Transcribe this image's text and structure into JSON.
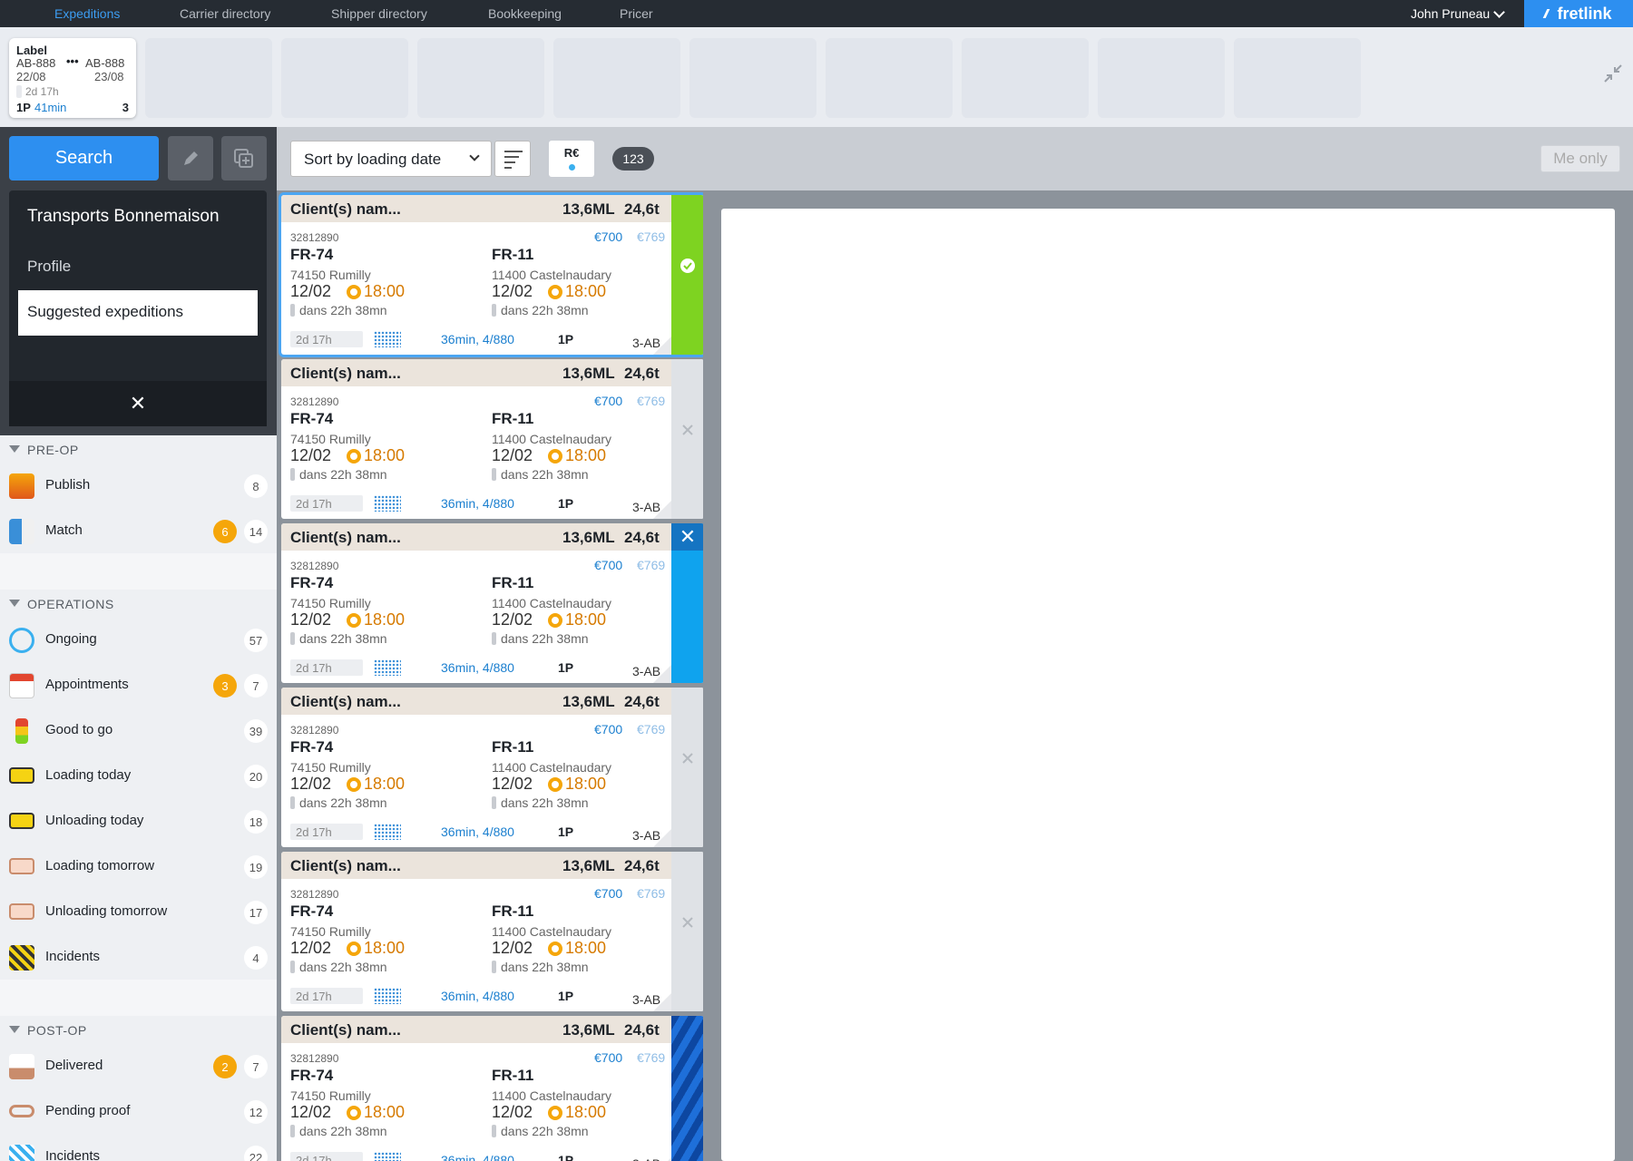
{
  "nav": {
    "items": [
      {
        "label": "Expeditions",
        "active": true
      },
      {
        "label": "Carrier directory",
        "active": false
      },
      {
        "label": "Shipper directory",
        "active": false
      },
      {
        "label": "Bookkeeping",
        "active": false
      },
      {
        "label": "Pricer",
        "active": false
      }
    ],
    "user": "John Pruneau",
    "brand": "fretlink"
  },
  "tab": {
    "label": "Label",
    "from_ref": "AB-888",
    "dots": "•••",
    "to_ref": "AB-888",
    "from_date": "22/08",
    "to_date": "23/08",
    "duration": "2d 17h",
    "pallets": "1P",
    "minutes": "41min",
    "count": "3"
  },
  "sidebar": {
    "search_label": "Search",
    "company": "Transports Bonnemaison",
    "profile": "Profile",
    "suggested": "Suggested expeditions",
    "close": "✕",
    "sections": [
      {
        "title": "PRE-OP",
        "items": [
          {
            "label": "Publish",
            "count": "8",
            "alert": null,
            "icon": "publish-icon"
          },
          {
            "label": "Match",
            "count": "14",
            "alert": "6",
            "icon": "truck-icon"
          }
        ]
      },
      {
        "title": "OPERATIONS",
        "items": [
          {
            "label": "Ongoing",
            "count": "57",
            "alert": null,
            "icon": "refresh-icon"
          },
          {
            "label": "Appointments",
            "count": "7",
            "alert": "3",
            "icon": "calendar-icon"
          },
          {
            "label": "Good to go",
            "count": "39",
            "alert": null,
            "icon": "traffic-light-icon"
          },
          {
            "label": "Loading today",
            "count": "20",
            "alert": null,
            "icon": "loading-icon"
          },
          {
            "label": "Unloading today",
            "count": "18",
            "alert": null,
            "icon": "unloading-icon"
          },
          {
            "label": "Loading tomorrow",
            "count": "19",
            "alert": null,
            "icon": "loading-tomorrow-icon"
          },
          {
            "label": "Unloading tomorrow",
            "count": "17",
            "alert": null,
            "icon": "unloading-tomorrow-icon"
          },
          {
            "label": "Incidents",
            "count": "4",
            "alert": null,
            "icon": "incident-icon"
          }
        ]
      },
      {
        "title": "POST-OP",
        "items": [
          {
            "label": "Delivered",
            "count": "7",
            "alert": "2",
            "icon": "delivered-icon"
          },
          {
            "label": "Pending proof",
            "count": "12",
            "alert": null,
            "icon": "glasses-icon"
          },
          {
            "label": "Incidents",
            "count": "22",
            "alert": null,
            "icon": "incident-icon"
          }
        ]
      }
    ]
  },
  "toolbar": {
    "sort_label": "Sort by loading date",
    "rc_label": "R€",
    "count": "123",
    "me_only": "Me only"
  },
  "card": {
    "client": "Client(s) nam...",
    "ml": "13,6ML",
    "weight": "24,6t",
    "ref": "32812890",
    "price": "€700",
    "price_alt": "€769",
    "from_code": "FR-74",
    "to_code": "FR-11",
    "from_city": "74150 Rumilly",
    "to_city": "11400 Castelnaudary",
    "from_date": "12/02",
    "to_date": "12/02",
    "from_time": "18:00",
    "to_time": "18:00",
    "from_rel": "dans 22h 38mn",
    "to_rel": "dans 22h 38mn",
    "duration": "2d 17h",
    "route": "36min, 4/880",
    "pallets": "1P",
    "code": "3-AB"
  },
  "cards": [
    {
      "status": "accepted",
      "side": "green"
    },
    {
      "status": "neutral",
      "side": "grey"
    },
    {
      "status": "rejected",
      "side": "blue"
    },
    {
      "status": "neutral",
      "side": "grey"
    },
    {
      "status": "neutral",
      "side": "grey"
    },
    {
      "status": "locked",
      "side": "striped"
    }
  ],
  "colors": {
    "accent": "#2d8ff0",
    "nav_bg": "#262c33",
    "alert": "#f5a60a",
    "accepted": "#7ed321",
    "rejected": "#0fa3ee"
  }
}
